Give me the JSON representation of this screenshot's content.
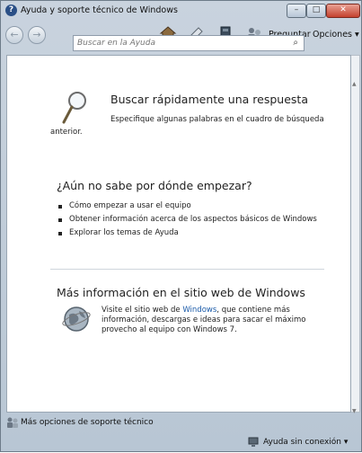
{
  "window": {
    "title": "Ayuda y soporte técnico de Windows"
  },
  "toolbar": {
    "ask_label": "Preguntar",
    "options_label": "Opciones",
    "options_arrow": "▾"
  },
  "search": {
    "placeholder": "Buscar en la Ayuda"
  },
  "section1": {
    "heading": "Buscar rápidamente una respuesta",
    "text_line1": "Especifique algunas palabras en el cuadro de búsqueda",
    "text_line2": "anterior."
  },
  "section2": {
    "heading": "¿Aún no sabe por dónde empezar?",
    "items": [
      "Cómo empezar a usar el equipo",
      "Obtener información acerca de los aspectos básicos de Windows",
      "Explorar los temas de Ayuda"
    ]
  },
  "section3": {
    "heading": "Más información en el sitio web de Windows",
    "text_pre": "Visite el sitio web de ",
    "text_link": "Windows",
    "text_post": ", que contiene más información, descargas e ideas para sacar el máximo provecho al equipo con Windows 7."
  },
  "footer": {
    "more_support": "Más opciones de soporte técnico",
    "offline_status": "Ayuda sin conexión",
    "offline_arrow": "▾"
  }
}
